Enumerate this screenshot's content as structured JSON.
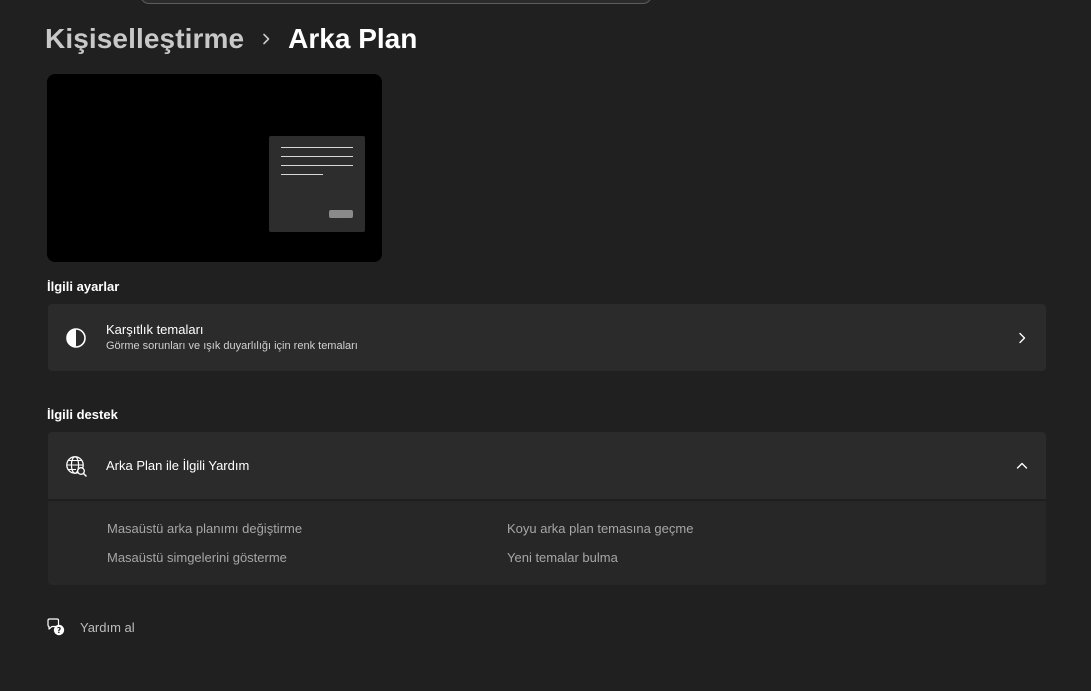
{
  "breadcrumb": {
    "parent": "Kişiselleştirme",
    "current": "Arka Plan"
  },
  "related_settings": {
    "title": "İlgili ayarlar",
    "items": [
      {
        "title": "Karşıtlık temaları",
        "subtitle": "Görme sorunları ve ışık duyarlılığı için renk temaları",
        "icon": "contrast-icon"
      }
    ]
  },
  "related_support": {
    "title": "İlgili destek",
    "expander": {
      "title": "Arka Plan ile İlgili Yardım",
      "icon": "globe-search-icon",
      "expanded": true,
      "links": [
        "Masaüstü arka planımı değiştirme",
        "Koyu arka plan temasına geçme",
        "Masaüstü simgelerini gösterme",
        "Yeni temalar bulma"
      ]
    }
  },
  "get_help": {
    "label": "Yardım al",
    "icon": "help-chat-icon"
  },
  "colors": {
    "background": "#202020",
    "card": "#2b2b2b",
    "link": "#a6a6a6"
  }
}
